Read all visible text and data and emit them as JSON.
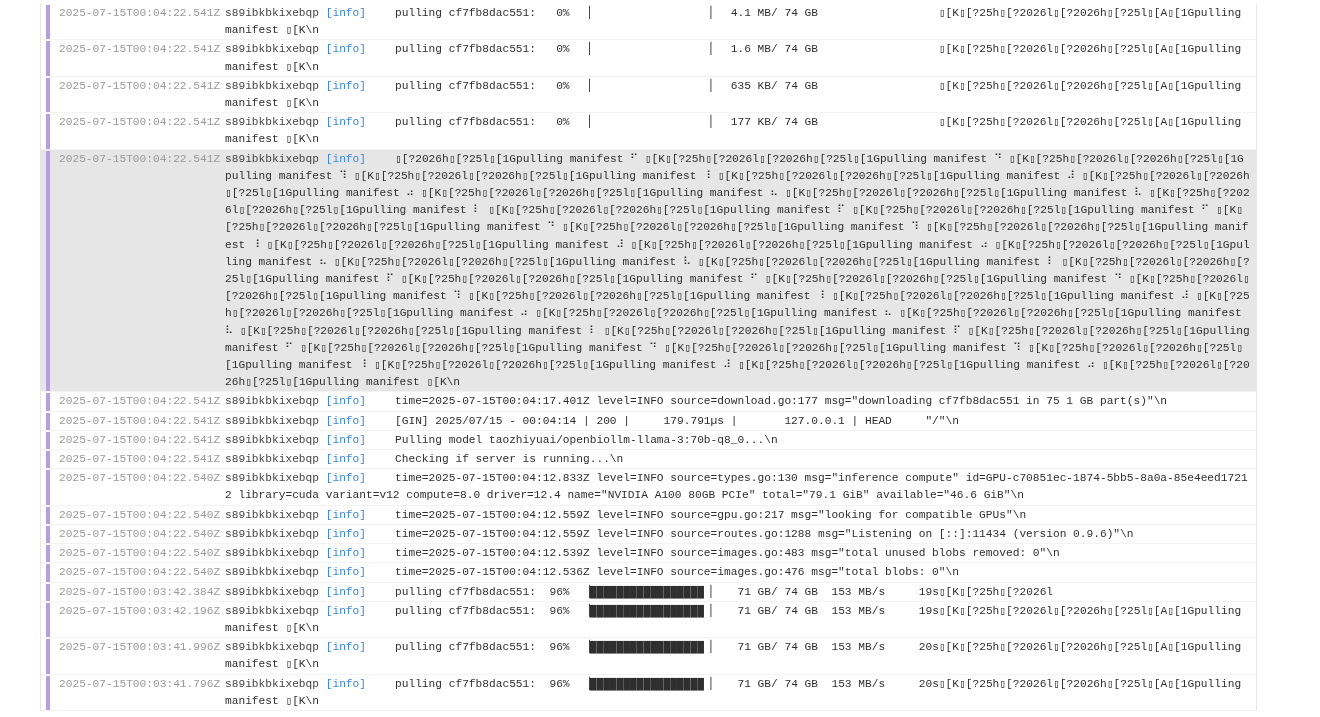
{
  "log_rows": [
    {
      "time": "2025-07-15T00:04:22.541Z",
      "pod": "s89ibkbkixebqp",
      "level": "[info]",
      "selected": false,
      "message": "pulling cf7fb8dac551:   0%  ▕                  ▏  4.1 MB/ 74 GB                  ▯[K▯[?25h▯[?2026l▯[?2026h▯[?25l▯[A▯[1Gpulling manifest ▯[K\\n"
    },
    {
      "time": "2025-07-15T00:04:22.541Z",
      "pod": "s89ibkbkixebqp",
      "level": "[info]",
      "selected": false,
      "message": "pulling cf7fb8dac551:   0%  ▕                  ▏  1.6 MB/ 74 GB                  ▯[K▯[?25h▯[?2026l▯[?2026h▯[?25l▯[A▯[1Gpulling manifest ▯[K\\n"
    },
    {
      "time": "2025-07-15T00:04:22.541Z",
      "pod": "s89ibkbkixebqp",
      "level": "[info]",
      "selected": false,
      "message": "pulling cf7fb8dac551:   0%  ▕                  ▏  635 KB/ 74 GB                  ▯[K▯[?25h▯[?2026l▯[?2026h▯[?25l▯[A▯[1Gpulling manifest ▯[K\\n"
    },
    {
      "time": "2025-07-15T00:04:22.541Z",
      "pod": "s89ibkbkixebqp",
      "level": "[info]",
      "selected": false,
      "message": "pulling cf7fb8dac551:   0%  ▕                  ▏  177 KB/ 74 GB                  ▯[K▯[?25h▯[?2026l▯[?2026h▯[?25l▯[A▯[1Gpulling manifest ▯[K\\n"
    },
    {
      "time": "2025-07-15T00:04:22.541Z",
      "pod": "s89ibkbkixebqp",
      "level": "[info]",
      "selected": true,
      "message": "▯[?2026h▯[?25l▯[1Gpulling manifest ⠋ ▯[K▯[?25h▯[?2026l▯[?2026h▯[?25l▯[1Gpulling manifest ⠙ ▯[K▯[?25h▯[?2026l▯[?2026h▯[?25l▯[1Gpulling manifest ⠹ ▯[K▯[?25h▯[?2026l▯[?2026h▯[?25l▯[1Gpulling manifest ⠸ ▯[K▯[?25h▯[?2026l▯[?2026h▯[?25l▯[1Gpulling manifest ⠼ ▯[K▯[?25h▯[?2026l▯[?2026h▯[?25l▯[1Gpulling manifest ⠴ ▯[K▯[?25h▯[?2026l▯[?2026h▯[?25l▯[1Gpulling manifest ⠦ ▯[K▯[?25h▯[?2026l▯[?2026h▯[?25l▯[1Gpulling manifest ⠧ ▯[K▯[?25h▯[?2026l▯[?2026h▯[?25l▯[1Gpulling manifest ⠇ ▯[K▯[?25h▯[?2026l▯[?2026h▯[?25l▯[1Gpulling manifest ⠏ ▯[K▯[?25h▯[?2026l▯[?2026h▯[?25l▯[1Gpulling manifest ⠋ ▯[K▯[?25h▯[?2026l▯[?2026h▯[?25l▯[1Gpulling manifest ⠙ ▯[K▯[?25h▯[?2026l▯[?2026h▯[?25l▯[1Gpulling manifest ⠹ ▯[K▯[?25h▯[?2026l▯[?2026h▯[?25l▯[1Gpulling manifest ⠸ ▯[K▯[?25h▯[?2026l▯[?2026h▯[?25l▯[1Gpulling manifest ⠼ ▯[K▯[?25h▯[?2026l▯[?2026h▯[?25l▯[1Gpulling manifest ⠴ ▯[K▯[?25h▯[?2026l▯[?2026h▯[?25l▯[1Gpulling manifest ⠦ ▯[K▯[?25h▯[?2026l▯[?2026h▯[?25l▯[1Gpulling manifest ⠧ ▯[K▯[?25h▯[?2026l▯[?2026h▯[?25l▯[1Gpulling manifest ⠇ ▯[K▯[?25h▯[?2026l▯[?2026h▯[?25l▯[1Gpulling manifest ⠏ ▯[K▯[?25h▯[?2026l▯[?2026h▯[?25l▯[1Gpulling manifest ⠋ ▯[K▯[?25h▯[?2026l▯[?2026h▯[?25l▯[1Gpulling manifest ⠙ ▯[K▯[?25h▯[?2026l▯[?2026h▯[?25l▯[1Gpulling manifest ⠹ ▯[K▯[?25h▯[?2026l▯[?2026h▯[?25l▯[1Gpulling manifest ⠸ ▯[K▯[?25h▯[?2026l▯[?2026h▯[?25l▯[1Gpulling manifest ⠼ ▯[K▯[?25h▯[?2026l▯[?2026h▯[?25l▯[1Gpulling manifest ⠴ ▯[K▯[?25h▯[?2026l▯[?2026h▯[?25l▯[1Gpulling manifest ⠦ ▯[K▯[?25h▯[?2026l▯[?2026h▯[?25l▯[1Gpulling manifest ⠧ ▯[K▯[?25h▯[?2026l▯[?2026h▯[?25l▯[1Gpulling manifest ⠇ ▯[K▯[?25h▯[?2026l▯[?2026h▯[?25l▯[1Gpulling manifest ⠏ ▯[K▯[?25h▯[?2026l▯[?2026h▯[?25l▯[1Gpulling manifest ⠋ ▯[K▯[?25h▯[?2026l▯[?2026h▯[?25l▯[1Gpulling manifest ⠙ ▯[K▯[?25h▯[?2026l▯[?2026h▯[?25l▯[1Gpulling manifest ⠹ ▯[K▯[?25h▯[?2026l▯[?2026h▯[?25l▯[1Gpulling manifest ⠸ ▯[K▯[?25h▯[?2026l▯[?2026h▯[?25l▯[1Gpulling manifest ⠼ ▯[K▯[?25h▯[?2026l▯[?2026h▯[?25l▯[1Gpulling manifest ⠴ ▯[K▯[?25h▯[?2026l▯[?2026h▯[?25l▯[1Gpulling manifest ▯[K\\n"
    },
    {
      "time": "2025-07-15T00:04:22.541Z",
      "pod": "s89ibkbkixebqp",
      "level": "[info]",
      "selected": false,
      "message": "time=2025-07-15T00:04:17.401Z level=INFO source=download.go:177 msg=\"downloading cf7fb8dac551 in 75 1 GB part(s)\"\\n"
    },
    {
      "time": "2025-07-15T00:04:22.541Z",
      "pod": "s89ibkbkixebqp",
      "level": "[info]",
      "selected": false,
      "message": "[GIN] 2025/07/15 - 00:04:14 | 200 |     179.791µs |       127.0.0.1 | HEAD     \"/\"\\n"
    },
    {
      "time": "2025-07-15T00:04:22.541Z",
      "pod": "s89ibkbkixebqp",
      "level": "[info]",
      "selected": false,
      "message": "Pulling model taozhiyuai/openbiollm-llama-3:70b-q8_0...\\n"
    },
    {
      "time": "2025-07-15T00:04:22.541Z",
      "pod": "s89ibkbkixebqp",
      "level": "[info]",
      "selected": false,
      "message": "Checking if server is running...\\n"
    },
    {
      "time": "2025-07-15T00:04:22.540Z",
      "pod": "s89ibkbkixebqp",
      "level": "[info]",
      "selected": false,
      "message": "time=2025-07-15T00:04:12.833Z level=INFO source=types.go:130 msg=\"inference compute\" id=GPU-c70851ec-1874-5bb5-8a0a-85e4eed17212 library=cuda variant=v12 compute=8.0 driver=12.4 name=\"NVIDIA A100 80GB PCIe\" total=\"79.1 GiB\" available=\"46.6 GiB\"\\n"
    },
    {
      "time": "2025-07-15T00:04:22.540Z",
      "pod": "s89ibkbkixebqp",
      "level": "[info]",
      "selected": false,
      "message": "time=2025-07-15T00:04:12.559Z level=INFO source=gpu.go:217 msg=\"looking for compatible GPUs\"\\n"
    },
    {
      "time": "2025-07-15T00:04:22.540Z",
      "pod": "s89ibkbkixebqp",
      "level": "[info]",
      "selected": false,
      "message": "time=2025-07-15T00:04:12.559Z level=INFO source=routes.go:1288 msg=\"Listening on [::]:11434 (version 0.9.6)\"\\n"
    },
    {
      "time": "2025-07-15T00:04:22.540Z",
      "pod": "s89ibkbkixebqp",
      "level": "[info]",
      "selected": false,
      "message": "time=2025-07-15T00:04:12.539Z level=INFO source=images.go:483 msg=\"total unused blobs removed: 0\"\\n"
    },
    {
      "time": "2025-07-15T00:04:22.540Z",
      "pod": "s89ibkbkixebqp",
      "level": "[info]",
      "selected": false,
      "message": "time=2025-07-15T00:04:12.536Z level=INFO source=images.go:476 msg=\"total blobs: 0\"\\n"
    },
    {
      "time": "2025-07-15T00:03:42.384Z",
      "pod": "s89ibkbkixebqp",
      "level": "[info]",
      "selected": false,
      "message": "pulling cf7fb8dac551:  96%  ▕█████████████████ ▏   71 GB/ 74 GB  153 MB/s     19s▯[K▯[?25h▯[?2026l"
    },
    {
      "time": "2025-07-15T00:03:42.196Z",
      "pod": "s89ibkbkixebqp",
      "level": "[info]",
      "selected": false,
      "message": "pulling cf7fb8dac551:  96%  ▕█████████████████ ▏   71 GB/ 74 GB  153 MB/s     19s▯[K▯[?25h▯[?2026l▯[?2026h▯[?25l▯[A▯[1Gpulling manifest ▯[K\\n"
    },
    {
      "time": "2025-07-15T00:03:41.996Z",
      "pod": "s89ibkbkixebqp",
      "level": "[info]",
      "selected": false,
      "message": "pulling cf7fb8dac551:  96%  ▕█████████████████ ▏   71 GB/ 74 GB  153 MB/s     20s▯[K▯[?25h▯[?2026l▯[?2026h▯[?25l▯[A▯[1Gpulling manifest ▯[K\\n"
    },
    {
      "time": "2025-07-15T00:03:41.796Z",
      "pod": "s89ibkbkixebqp",
      "level": "[info]",
      "selected": false,
      "message": "pulling cf7fb8dac551:  96%  ▕█████████████████ ▏   71 GB/ 74 GB  153 MB/s     20s▯[K▯[?25h▯[?2026l▯[?2026h▯[?25l▯[A▯[1Gpulling manifest ▯[K\\n"
    }
  ]
}
